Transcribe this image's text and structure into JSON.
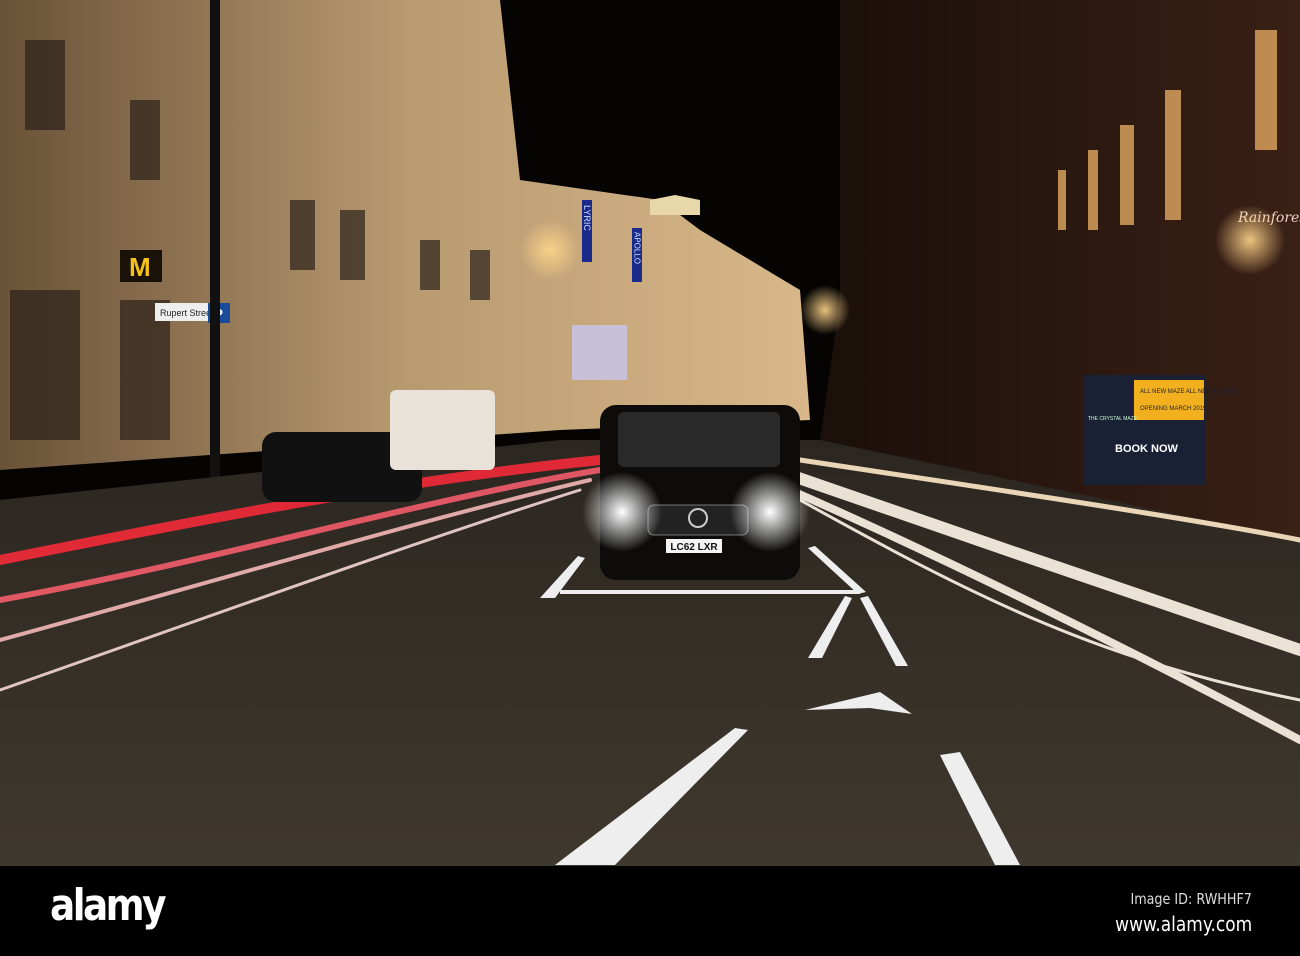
{
  "photo": {
    "signs": {
      "theatre_1": "LYRIC",
      "theatre_2": "APOLLO",
      "street_sign": "Rupert Street",
      "mcdonalds": "M",
      "billboard_headline": "BOOK NOW",
      "billboard_opening": "OPENING MARCH 2019!",
      "billboard_tagline": "ALL NEW MAZE ALL NEW GAMES!",
      "billboard_brand": "THE CRYSTAL MAZE",
      "shop_sign": "Rainforest",
      "parking_sign": "P"
    },
    "vehicle": {
      "plate": "LC62 LXR"
    },
    "colors": {
      "sky": "#050403",
      "left_building": "#b89a70",
      "right_building": "#2a1710",
      "road": "#3a342c",
      "red_trail": "#ff2a3a",
      "white_trail": "#fff6e8"
    }
  },
  "footer": {
    "logo": "alamy",
    "image_id": "Image ID: RWHHF7",
    "url": "www.alamy.com"
  }
}
